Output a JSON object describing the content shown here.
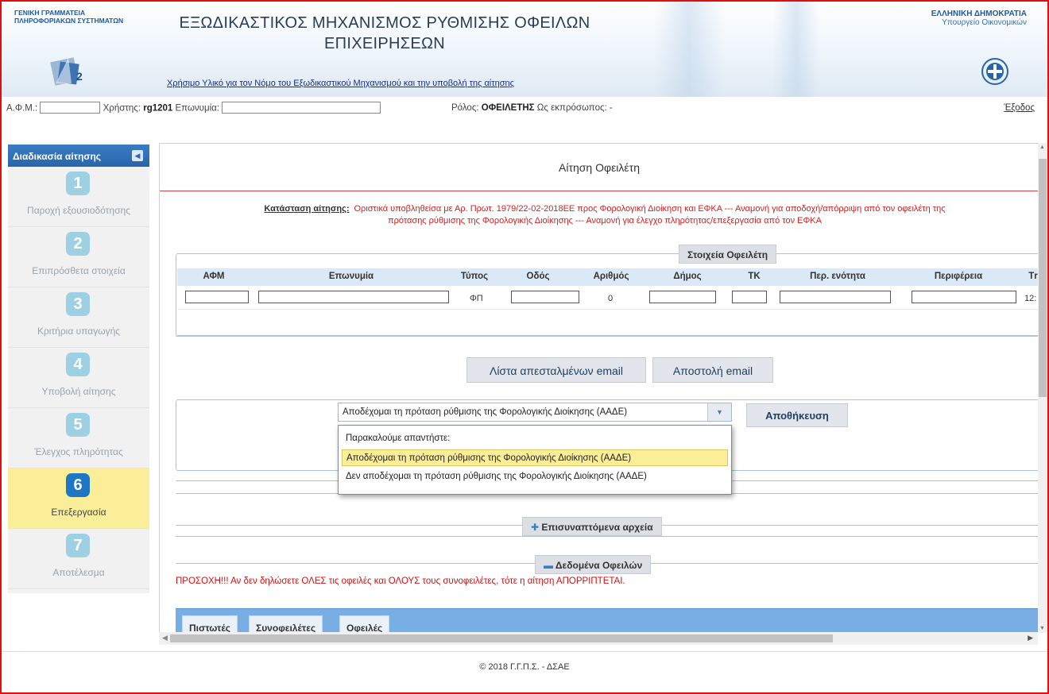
{
  "header": {
    "org_line1": "ΓΕΝΙΚΗ ΓΡΑΜΜΑΤΕΙΑ",
    "org_line2": "ΠΛΗΡΟΦΟΡΙΑΚΩΝ ΣΥΣΤΗΜΑΤΩΝ",
    "title_line1": "ΕΞΩΔΙΚΑΣΤΙΚΟΣ ΜΗΧΑΝΙΣΜΟΣ ΡΥΘΜΙΣΗΣ ΟΦΕΙΛΩΝ",
    "title_line2": "ΕΠΙΧΕΙΡΗΣΕΩΝ",
    "useful_link": "Χρήσιμο Υλικό για τον Νόμο του Εξωδικαστικού Μηχανισμού και την υποβολή της αίτησης",
    "republic_line1": "ΕΛΛΗΝΙΚΗ ΔΗΜΟΚΡΑΤΙΑ",
    "republic_line2": "Υπουργείο Οικονομικών"
  },
  "userbar": {
    "afm_label": "Α.Φ.Μ.:",
    "user_label": "Χρήστης:",
    "user_value": "rg1201",
    "name_label": "Επωνυμία:",
    "role_label": "Ρόλος:",
    "role_value": "ΟΦΕΙΛΕΤΗΣ",
    "rep_label": "Ως εκπρόσωπος:",
    "rep_value": "-",
    "logout": "Έξοδος"
  },
  "sidebar": {
    "title": "Διαδικασία αίτησης",
    "steps": [
      {
        "num": "1",
        "label": "Παροχή εξουσιοδότησης"
      },
      {
        "num": "2",
        "label": "Επιπρόσθετα στοιχεία"
      },
      {
        "num": "3",
        "label": "Κριτήρια υπαγωγής"
      },
      {
        "num": "4",
        "label": "Υποβολή αίτησης"
      },
      {
        "num": "5",
        "label": "Έλεγχος πληρότητας"
      },
      {
        "num": "6",
        "label": "Επεξεργασία"
      },
      {
        "num": "7",
        "label": "Αποτέλεσμα"
      }
    ],
    "active_step": "6"
  },
  "main": {
    "page_title": "Αίτηση Οφειλέτη",
    "status_label": "Κατάσταση αίτησης:",
    "status_line1": "Οριστικά υποβληθείσα με Αρ. Πρωτ. 1979/22-02-2018ΕΕ προς Φορολογική Διοίκηση και ΕΦΚΑ --- Αναμονή για αποδοχή/απόρριψη από τον οφειλέτη της",
    "status_line2": "πρότασης ρύθμισης της Φορολογικής Διοίκησης --- Αναμονή για έλεγχο πληρότητας/επεξεργασία από τον ΕΦΚΑ",
    "debtor_section": "Στοιχεία Οφειλέτη",
    "table_headers": [
      "ΑΦΜ",
      "Επωνυμία",
      "Τύπος",
      "Οδός",
      "Αριθμός",
      "Δήμος",
      "ΤΚ",
      "Περ. ενότητα",
      "Περιφέρεια",
      "Τr"
    ],
    "row": {
      "type": "ΦΠ",
      "number": "0",
      "last": "12:"
    },
    "btn_email_list": "Λίστα απεσταλμένων email",
    "btn_send_email": "Αποστολή email",
    "select_value": "Αποδέχομαι τη πρόταση ρύθμισης της Φορολογικής Διοίκησης (ΑΑΔΕ)",
    "btn_save": "Αποθήκευση",
    "dropdown_options": [
      "Παρακαλούμε απαντήστε:",
      "Αποδέχομαι τη πρόταση ρύθμισης της Φορολογικής Διοίκησης (ΑΑΔΕ)",
      "Δεν αποδέχομαι τη πρόταση ρύθμισης της Φορολογικής Διοίκησης (ΑΑΔΕ)"
    ],
    "attachments_section": "Επισυναπτόμενα αρχεία",
    "debts_section": "Δεδομένα Οφειλών",
    "warning": "ΠΡΟΣΟΧΗ!!! Αν δεν δηλώσετε ΟΛΕΣ τις οφειλές και ΟΛΟΥΣ τους συνοφειλέτες, τότε η αίτηση ΑΠΟΡΡΙΠΤΕΤΑΙ.",
    "tabs": [
      "Πιστωτές",
      "Συνοφειλέτες",
      "Οφειλές"
    ]
  },
  "footer": {
    "copyright": "© 2018 Γ.Γ.Π.Σ. - ΔΣΑΕ"
  },
  "colors": {
    "accent": "#2866ab",
    "active_step": "#fbee99",
    "warning": "#d01010",
    "frame": "#e01010"
  }
}
